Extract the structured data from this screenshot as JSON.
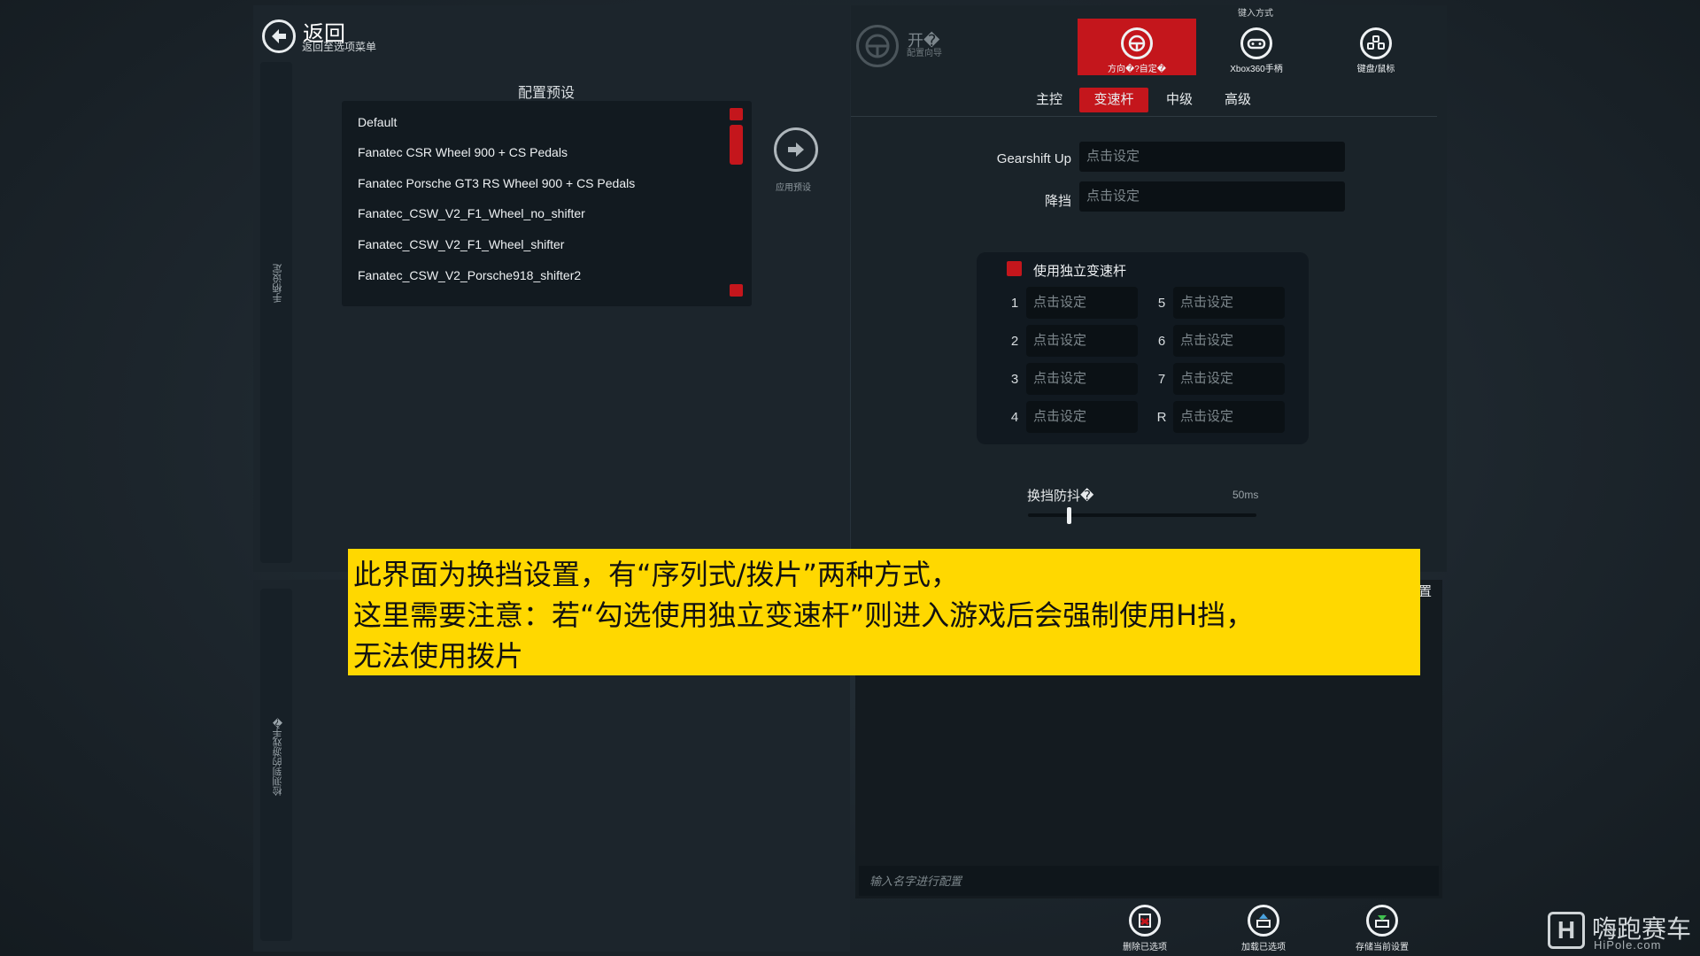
{
  "header": {
    "back_title": "返回",
    "back_subtitle": "返回至选项菜单",
    "input_method_label": "键入方式",
    "wizard_title": "开�",
    "wizard_subtitle": "配置向导"
  },
  "left_panel": {
    "vertical_label_top": "手柄设定",
    "vertical_label_bottom": "检测到的游戏手�",
    "preset_title": "配置预设",
    "presets": [
      "Default",
      "Fanatec CSR Wheel 900 + CS Pedals",
      "Fanatec Porsche GT3 RS Wheel 900 + CS Pedals",
      "Fanatec_CSW_V2_F1_Wheel_no_shifter",
      "Fanatec_CSW_V2_F1_Wheel_shifter",
      "Fanatec_CSW_V2_Porsche918_shifter2"
    ],
    "apply_label": "应用预设"
  },
  "input_modes": [
    {
      "label": "方向�?自定�",
      "active": true
    },
    {
      "label": "Xbox360手柄",
      "active": false
    },
    {
      "label": "键盘/鼠标",
      "active": false
    }
  ],
  "tabs": [
    "主控",
    "变速杆",
    "中级",
    "高级"
  ],
  "active_tab": "变速杆",
  "gearshift": {
    "up_label": "Gearshift Up",
    "up_value": "点击设定",
    "down_label": "降挡",
    "down_value": "点击设定"
  },
  "h_shifter": {
    "checkbox_label": "使用独立变速杆",
    "checked": true,
    "gears": [
      {
        "num": "1",
        "value": "点击设定"
      },
      {
        "num": "2",
        "value": "点击设定"
      },
      {
        "num": "3",
        "value": "点击设定"
      },
      {
        "num": "4",
        "value": "点击设定"
      },
      {
        "num": "5",
        "value": "点击设定"
      },
      {
        "num": "6",
        "value": "点击设定"
      },
      {
        "num": "7",
        "value": "点击设定"
      },
      {
        "num": "R",
        "value": "点击设定"
      }
    ]
  },
  "debounce": {
    "label": "换挡防抖�",
    "value_text": "50ms",
    "level_fraction": 0.18
  },
  "right_bottom": {
    "fragment_text": "置",
    "name_placeholder": "输入名字进行配置",
    "buttons": [
      "删除已选项",
      "加载已选项",
      "存储当前设置"
    ]
  },
  "banner": {
    "lines": [
      "此界面为换挡设置，有“序列式/拨片”两种方式，",
      "这里需要注意：若“勾选使用独立变速杆”则进入游戏后会强制使用H挡，",
      "无法使用拨片"
    ]
  },
  "watermark": {
    "logo_letter": "H",
    "cn": "嗨跑赛车",
    "en": "HiPole.com"
  },
  "colors": {
    "accent": "#c4161c",
    "banner": "#ffd800",
    "background": "#1d262d"
  }
}
